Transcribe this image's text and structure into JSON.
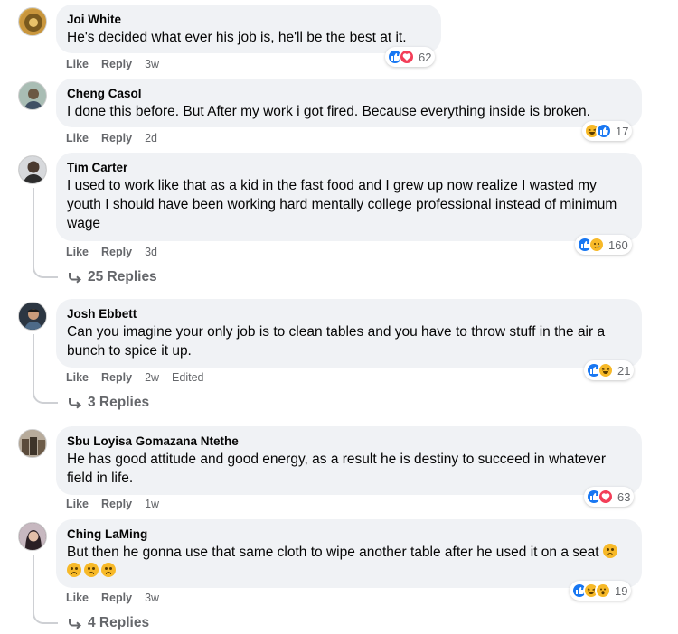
{
  "comments": [
    {
      "name": "Joi White",
      "text": "He's decided what ever his job is, he'll be the best at it.",
      "like": "Like",
      "reply": "Reply",
      "time": "3w",
      "reactions": [
        "like",
        "love"
      ],
      "reaction_count": "62"
    },
    {
      "name": "Cheng Casol",
      "text": "I done this before. But After my work i got fired. Because everything inside is broken.",
      "like": "Like",
      "reply": "Reply",
      "time": "2d",
      "reactions": [
        "haha",
        "like"
      ],
      "reaction_count": "17"
    },
    {
      "name": "Tim Carter",
      "text": "I used to work like that as a kid in the fast food and I grew up now realize I wasted my youth I should have been working hard mentally college professional instead of minimum wage",
      "like": "Like",
      "reply": "Reply",
      "time": "3d",
      "reactions": [
        "like",
        "sad"
      ],
      "reaction_count": "160",
      "replies_label": "25 Replies"
    },
    {
      "name": "Josh Ebbett",
      "text": "Can you imagine your only job is to clean tables and you have to throw stuff in the air a bunch to spice it up.",
      "like": "Like",
      "reply": "Reply",
      "time": "2w",
      "edited": "Edited",
      "reactions": [
        "like",
        "haha"
      ],
      "reaction_count": "21",
      "replies_label": "3 Replies"
    },
    {
      "name": "Sbu Loyisa Gomazana Ntethe",
      "text": "He has good attitude and good energy, as a result he is destiny to succeed in whatever field in life.",
      "like": "Like",
      "reply": "Reply",
      "time": "1w",
      "reactions": [
        "like",
        "love"
      ],
      "reaction_count": "63"
    },
    {
      "name": "Ching LaMing",
      "text": "But then he gonna use that same cloth to wipe another table after he used it on a seat",
      "like": "Like",
      "reply": "Reply",
      "time": "3w",
      "reactions": [
        "like",
        "haha",
        "wow"
      ],
      "reaction_count": "19",
      "replies_label": "4 Replies"
    }
  ],
  "colors": {
    "bubble": "#f0f2f5",
    "meta_text": "#65676b",
    "like_blue": "#1877f2",
    "love_red": "#f33e58",
    "emoji_yellow": "#f7b928"
  }
}
